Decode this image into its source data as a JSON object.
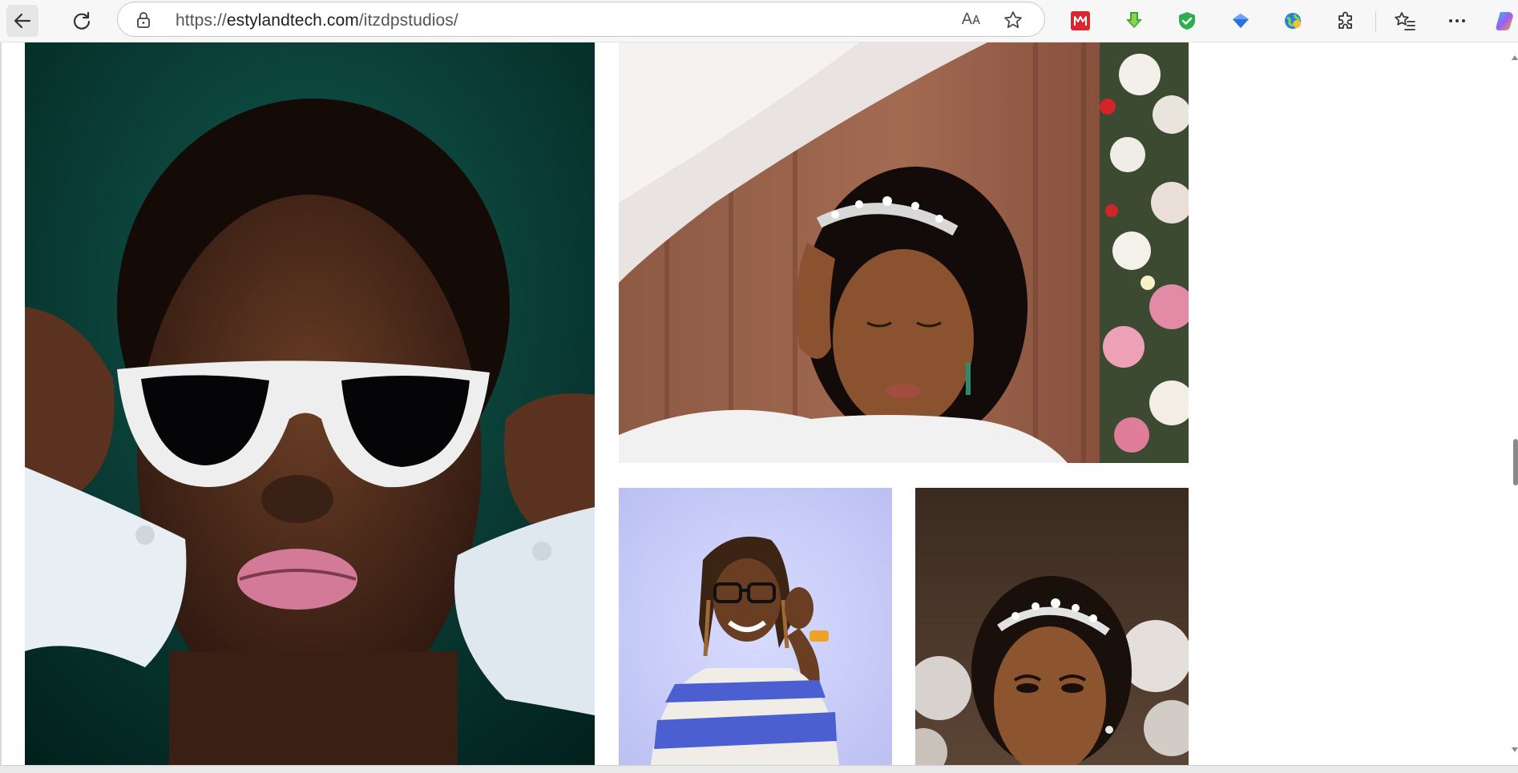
{
  "browser": {
    "url_prefix": "https://",
    "url_domain": "estylandtech.com",
    "url_path": "/itzdpstudios/",
    "read_aloud_label": "Aᴀ",
    "icons": {
      "back": "back-arrow-icon",
      "refresh": "refresh-icon",
      "lock": "lock-icon",
      "favorite": "star-icon",
      "extensions": [
        "mega-extension-icon",
        "download-extension-icon",
        "shield-extension-icon",
        "diamond-extension-icon",
        "globe-extension-icon",
        "puzzle-icon"
      ],
      "favorites": "favorites-list-icon",
      "menu": "more-dots-icon",
      "copilot": "copilot-icon"
    }
  },
  "gallery": {
    "photos": [
      {
        "alt": "Portrait of woman wearing white half-moon sunglasses",
        "background": "#0d4b42"
      },
      {
        "alt": "Bride touching her hair wearing a tiara",
        "background": "#8b5340"
      },
      {
        "alt": "Smiling man with locs adjusting glasses",
        "background": "#c7cbf5"
      },
      {
        "alt": "Bride with tiara and makeup",
        "background": "#4a3b30"
      }
    ]
  }
}
